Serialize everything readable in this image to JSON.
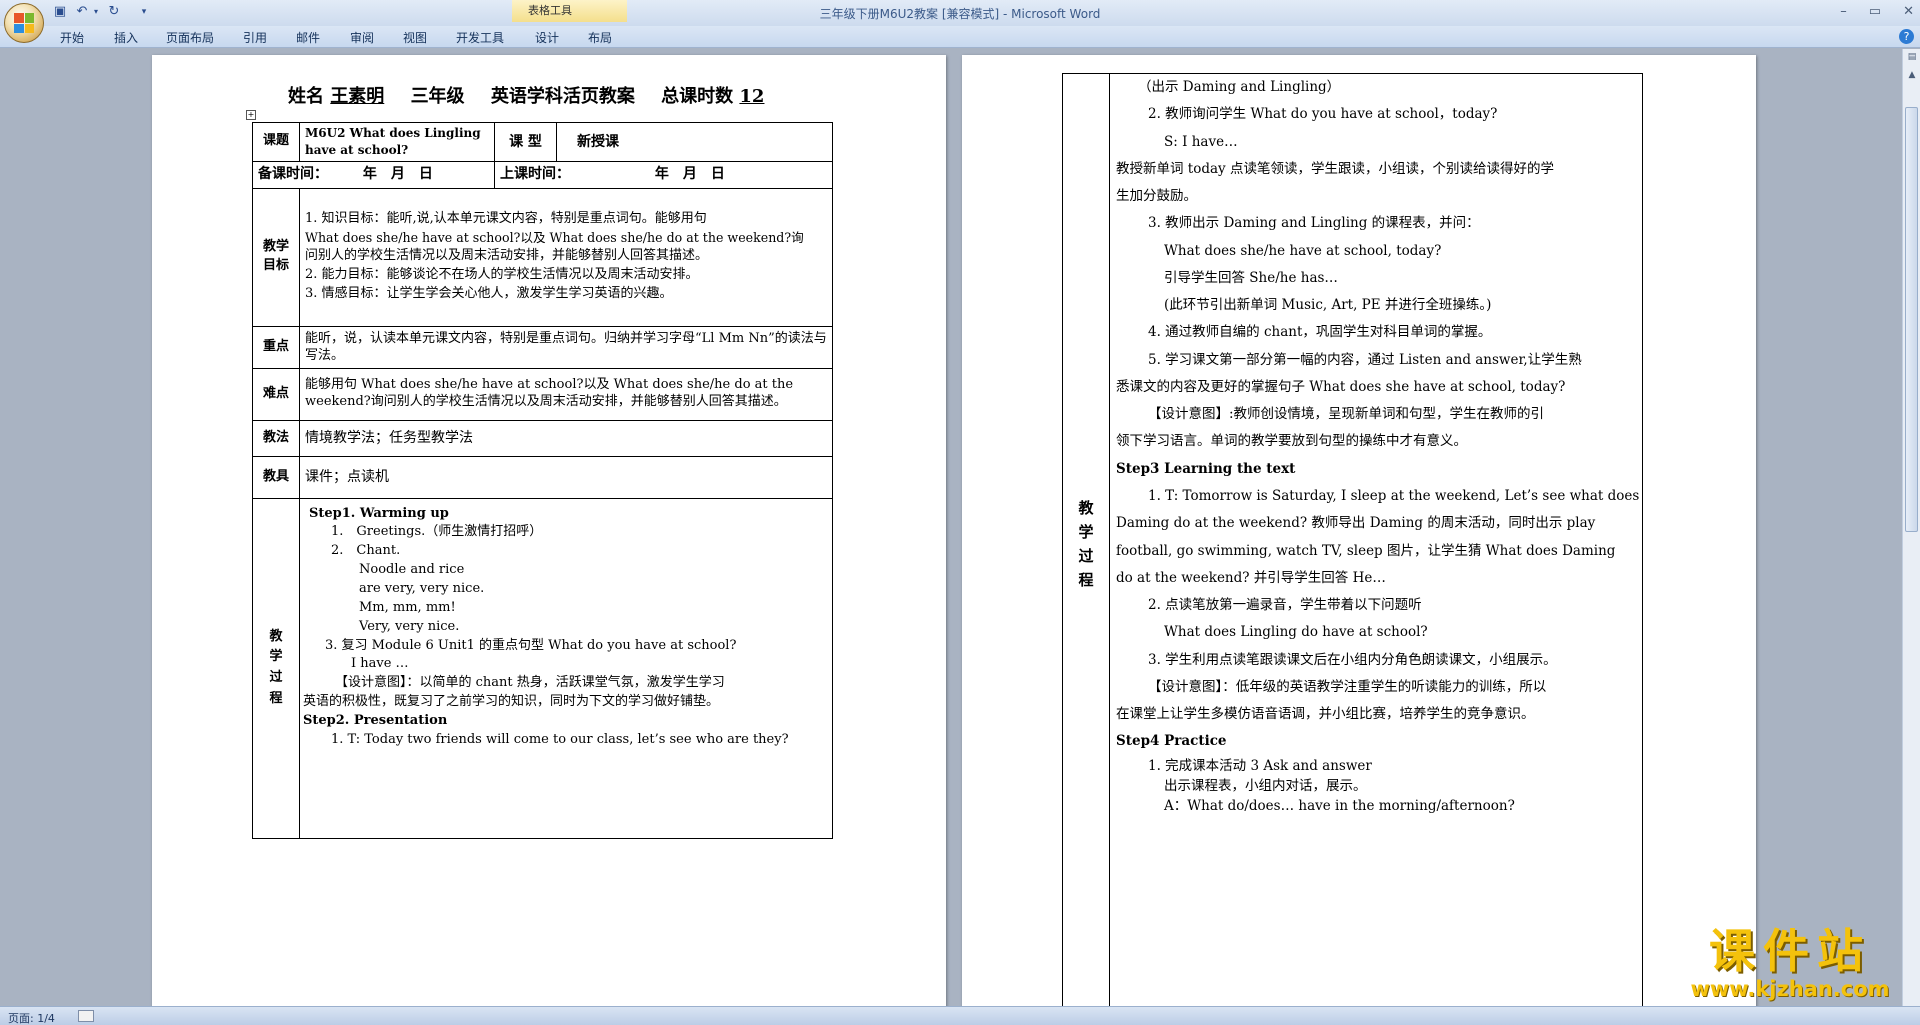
{
  "window": {
    "title": "三年级下册M6U2教案 [兼容模式] - Microsoft Word",
    "context_tab_group": "表格工具",
    "colors": {
      "ribbon": "#cddbee",
      "workspace": "#a9b3c2",
      "watermark": "#f4c20c"
    }
  },
  "ribbon_tabs": [
    "开始",
    "插入",
    "页面布局",
    "引用",
    "邮件",
    "审阅",
    "视图",
    "开发工具",
    "设计",
    "布局"
  ],
  "status": {
    "page_count": "页面: 1/4"
  },
  "watermark": {
    "text": "课件站",
    "url": "www.kjzhan.com"
  },
  "page1": {
    "heading": {
      "name_label": "姓名",
      "name": "王素明",
      "grade": "三年级",
      "subject": "英语学科活页教案",
      "total_label": "总课时数",
      "total": "12"
    },
    "rows": {
      "topic_label": "课题",
      "topic": "M6U2 What does Lingling have at school?",
      "type_label": "课 型",
      "type": "新授课",
      "prep_label": "备课时间：",
      "prep_date": "年　月　日",
      "class_label": "上课时间：",
      "class_date": "年　月　日",
      "goals_label": "教学目标",
      "goals": [
        "1. 知识目标：能听,说,认本单元课文内容，特别是重点词句。能够用句",
        "What does she/he have at school?以及 What does she/he do at the weekend?询",
        "问别人的学校生活情况以及周末活动安排，并能够替别人回答其描述。",
        "2. 能力目标：能够谈论不在场人的学校生活情况以及周末活动安排。",
        "3. 情感目标：让学生学会关心他人，激发学生学习英语的兴趣。"
      ],
      "key_label": "重点",
      "key": "能听，说，认读本单元课文内容，特别是重点词句。归纳并学习字母“Ll Mm Nn”的读法与写法。",
      "diff_label": "难点",
      "diff": "能够用句 What does she/he have at school?以及 What does she/he do at the weekend?询问别人的学校生活情况以及周末活动安排，并能够替别人回答其描述。",
      "method_label": "教法",
      "method": "情境教学法；任务型教学法",
      "tools_label": "教具",
      "tools": "课件；点读机",
      "process_label": "教学过程",
      "process": [
        "Step1. Warming up",
        "1.　Greetings.（师生激情打招呼）",
        "2.　Chant.",
        "Noodle and rice",
        "are very, very nice.",
        "Mm, mm, mm!",
        "Very, very nice.",
        "3. 复习 Module 6 Unit1 的重点句型 What do you have at school?",
        "I have …",
        "【设计意图】：以简单的 chant 热身，活跃课堂气氛，激发学生学习",
        "英语的积极性，既复习了之前学习的知识，同时为下文的学习做好铺垫。",
        "Step2. Presentation",
        "1. T: Today two friends will come to our class, let’s see who are they?"
      ]
    }
  },
  "page2": {
    "process_label": "教学过程",
    "lines": [
      "（出示 Daming and Lingling）",
      "2. 教师询问学生 What do you have at school，today?",
      "S: I have…",
      "教授新单词 today 点读笔领读，学生跟读，小组读，个别读给读得好的学",
      "生加分鼓励。",
      "3. 教师出示 Daming and Lingling 的课程表，并问：",
      "What does she/he have at school, today?",
      "引导学生回答 She/he has…",
      "(此环节引出新单词 Music, Art, PE 并进行全班操练。)",
      "4. 通过教师自编的 chant，巩固学生对科目单词的掌握。",
      "5. 学习课文第一部分第一幅的内容，通过 Listen and answer,让学生熟",
      "悉课文的内容及更好的掌握句子 What does she have at school, today?",
      "【设计意图】:教师创设情境，呈现新单词和句型，学生在教师的引",
      "领下学习语言。单词的教学要放到句型的操练中才有意义。",
      "Step3 Learning the text",
      "1. T: Tomorrow is Saturday, I sleep at the weekend, Let’s see what does",
      "Daming do at the weekend? 教师导出 Daming 的周末活动，同时出示 play",
      "football, go swimming, watch TV, sleep 图片，让学生猜 What does Daming",
      "do at the weekend? 并引导学生回答 He…",
      "2. 点读笔放第一遍录音，学生带着以下问题听",
      "What does Lingling do have at school?",
      "3. 学生利用点读笔跟读课文后在小组内分角色朗读课文，小组展示。",
      "【设计意图】：低年级的英语教学注重学生的听读能力的训练，所以",
      "在课堂上让学生多模仿语音语调，并小组比赛，培养学生的竞争意识。",
      "Step4 Practice",
      "1. 完成课本活动 3 Ask and answer",
      "出示课程表，小组内对话，展示。",
      "A：What do/does… have in the morning/afternoon?"
    ]
  }
}
